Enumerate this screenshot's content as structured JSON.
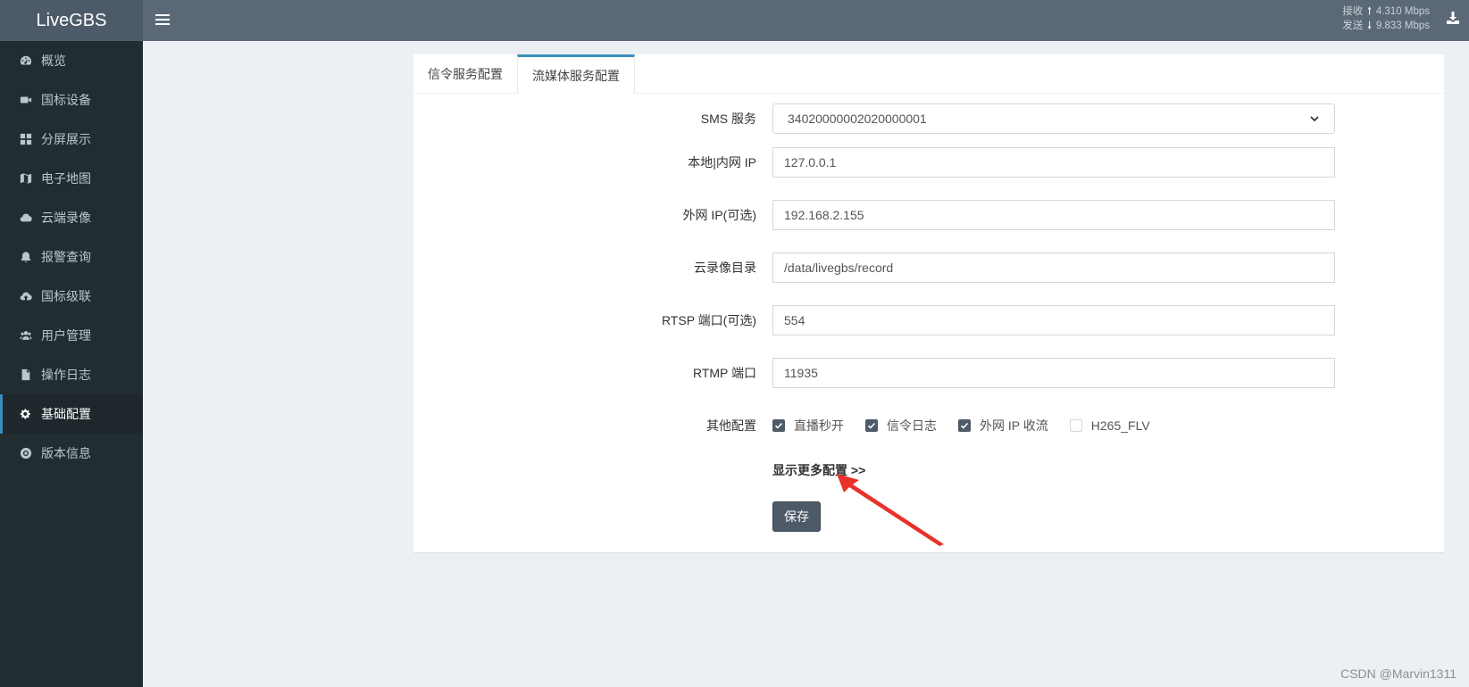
{
  "brand": "LiveGBS",
  "sidebar": {
    "items": [
      {
        "label": "概览",
        "icon": "dashboard-icon"
      },
      {
        "label": "国标设备",
        "icon": "video-camera-icon"
      },
      {
        "label": "分屏展示",
        "icon": "grid-icon"
      },
      {
        "label": "电子地图",
        "icon": "map-icon"
      },
      {
        "label": "云端录像",
        "icon": "cloud-icon"
      },
      {
        "label": "报警查询",
        "icon": "bell-icon"
      },
      {
        "label": "国标级联",
        "icon": "cloud-upload-icon"
      },
      {
        "label": "用户管理",
        "icon": "users-icon"
      },
      {
        "label": "操作日志",
        "icon": "file-icon"
      },
      {
        "label": "基础配置",
        "icon": "gears-icon"
      },
      {
        "label": "版本信息",
        "icon": "lifebuoy-icon"
      }
    ],
    "active_index": 9
  },
  "topbar": {
    "receive_label": "接收",
    "receive_rate": "4.310 Mbps",
    "send_label": "发送",
    "send_rate": "9.833 Mbps"
  },
  "tabs": [
    {
      "label": "信令服务配置"
    },
    {
      "label": "流媒体服务配置"
    }
  ],
  "active_tab": 1,
  "form": {
    "sms_service": {
      "label": "SMS 服务",
      "value": "34020000002020000001"
    },
    "local_ip": {
      "label": "本地|内网 IP",
      "value": "127.0.0.1"
    },
    "wan_ip": {
      "label": "外网 IP(可选)",
      "value": "192.168.2.155"
    },
    "record_dir": {
      "label": "云录像目录",
      "value": "/data/livegbs/record"
    },
    "rtsp_port": {
      "label": "RTSP 端口(可选)",
      "value": "554"
    },
    "rtmp_port": {
      "label": "RTMP 端口",
      "value": "11935"
    },
    "other": {
      "label": "其他配置",
      "options": [
        {
          "label": "直播秒开",
          "checked": true
        },
        {
          "label": "信令日志",
          "checked": true
        },
        {
          "label": "外网 IP 收流",
          "checked": true
        },
        {
          "label": "H265_FLV",
          "checked": false
        }
      ]
    },
    "more_link": "显示更多配置 >>",
    "save_label": "保存"
  },
  "colors": {
    "accent": "#3c8dbc",
    "sidebar_bg": "#222d32",
    "topbar_bg": "#5b6977",
    "button_bg": "#4d5b69",
    "annotation_arrow": "#e8312a"
  },
  "watermark": "CSDN @Marvin1311"
}
